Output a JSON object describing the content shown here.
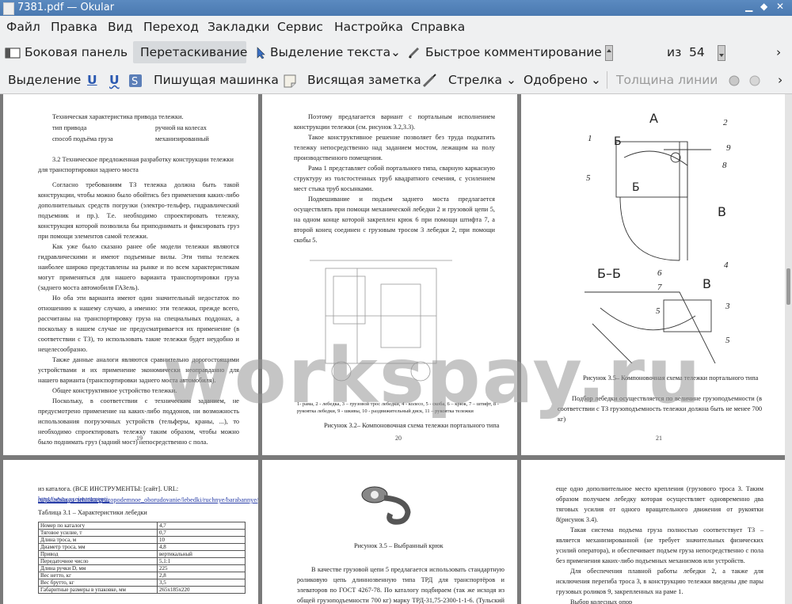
{
  "window": {
    "title": "7381.pdf — Okular"
  },
  "menu": [
    "Файл",
    "Правка",
    "Вид",
    "Переход",
    "Закладки",
    "Сервис",
    "Настройка",
    "Справка"
  ],
  "toolbar1": {
    "sidebar": "Боковая панель",
    "drag": "Перетаскивание",
    "text_select": "Выделение текста",
    "quick_comment": "Быстрое комментирование",
    "page_current": "20",
    "page_of": "из",
    "page_total": "54"
  },
  "toolbar2": {
    "selection": "Выделение",
    "typewriter": "Пишущая машинка",
    "note": "Висящая заметка",
    "arrow": "Стрелка",
    "approved": "Одобрено",
    "line_width": "Толщина линии"
  },
  "watermark": "workspay.ru",
  "page19": {
    "l1": "Техническая характеристика привода тележки.",
    "l2a": "тип привода",
    "l2b": "ручной на колесах",
    "l3a": "способ подъёма груза",
    "l3b": "механизированный",
    "h": "3.2 Техническое предложенная разработку конструкции тележки для транспортировки заднего моста",
    "p1": "Согласно требованиям ТЗ тележка должна быть такой конструкции, чтобы можно было обойтись без применения каких-либо дополнительных средств погрузки (электро-тельфер, гидравлический подъемник и пр.). Т.е. необходимо спроектировать тележку, конструкция которой позволила бы приподнимать и фиксировать груз при помощи элементов самой тележки.",
    "p2": "Как уже было сказано ранее обе модели тележки являются гидравлическими и имеют подъемные вилы. Эти типы тележек наиболее широко представлены на рынке и по всем характеристикам могут применяться для нашего варианта транспортировки груза (заднего моста автомобиля ГАЗель).",
    "p3": "Но оба эти варианта имеют один значительный недостаток по отношению к нашему случаю, а именно: эти тележки, прежде всего, рассчитаны на транспортировку груза на специальных поддонах, а поскольку в нашем случае не предусматривается их применение (в соответствии с ТЗ), то использовать такие тележки будет неудобно и нецелесообразно.",
    "p4": "Также данные аналоги являются сравнительно дорогостоящими устройствами и их применение экономически неоправданно для нашего варианта (транспортировки заднего моста автомобиля).",
    "p5": "Общее конструктивное устройство тележки.",
    "p6": "Поскольку, в соответствии с техническим заданием, не предусмотрено применение на каких-либо поддонов, ни возможность использования погрузочных устройств (тельферы, краны, ...), то необходимо спроектировать тележку таким образом, чтобы можно было поднимать груз (задний мост) непосредственно с пола.",
    "num": "19"
  },
  "page20": {
    "p1": "Поэтому предлагается вариант с портальным исполнением конструкции тележки (см. рисунок 3.2,3.3).",
    "p2": "Такое конструктивное решение позволяет без труда подкатить тележку непосредственно над заданием мостом, лежащим на полу производственного помещения.",
    "p3": "Рама 1 представляет собой портального типа, сварную каркасную структуру из толстостенных труб квадратного сечения, с усилением мест стыка труб косынками.",
    "p4": "Подвешивание и подъем заднего моста предлагается осуществлять при помощи механической лебедки 2 и грузовой цепи 5, на одном конце которой закреплен крюк 6 при помощи штифта 7, а второй конец соединен с грузовым тросом 3 лебедки 2, при помощи скобы 5.",
    "legend": "1- рама, 2 - лебедка, 3 – грузовой трос лебедки, 4 - колесо, 5 - скоба, 6 – крюк, 7 – штифт, 8 - рукоятка лебедки, 9 - шкивы, 10 - раздвижительный диск, 11 – рукоятка тележки",
    "caption": "Рисунок 3.2– Компоновочная схема тележки портального типа",
    "num": "20"
  },
  "page21": {
    "labelA": "А",
    "labelB1": "Б",
    "labelB2": "Б",
    "labelV1": "В",
    "labelBB": "Б–Б",
    "labelV2": "В",
    "n1": "1",
    "n2": "2",
    "n9": "9",
    "n8": "8",
    "n5": "5",
    "n4": "4",
    "n6": "6",
    "n7": "7",
    "n3": "3",
    "n5b": "5",
    "n5c": "5",
    "caption": "Рисунок 3.5– Компоновочная схема тележки портального типа",
    "p1": "Подбор лебедки осуществляется по величине грузоподъемности (в соответствии с ТЗ грузоподъемность тележки должна быть не менее 700 кг)",
    "num": "21"
  },
  "page22": {
    "l1": "из каталога. (ВСЕ ИНСТРУМЕНТЫ: [сайт]. URL:",
    "link1": "http://www.vseinstrumenti.",
    "link2": "ru/skladskaya_tehnika/gruzopodemnoe_oborudovanie/lebedki/ruchnye/barabannye/)",
    "table_title": "Таблица 3.1 – Характеристики лебедки",
    "rows": [
      [
        "Номер по каталогу",
        "4,7"
      ],
      [
        "Тяговое усилие, т",
        "0,7"
      ],
      [
        "Длина троса, м",
        "10"
      ],
      [
        "Диаметр троса, мм",
        "4,8"
      ],
      [
        "Привод",
        "вертикальный"
      ],
      [
        "Передаточное число",
        "5,1:1"
      ],
      [
        "Длина ручки D, мм",
        "225"
      ],
      [
        "Вес нетто, кг",
        "2,8"
      ],
      [
        "Вес брутто, кг",
        "3,5"
      ],
      [
        "Габаритные размеры в упаковке, мм",
        "265x185x220"
      ]
    ]
  },
  "page23": {
    "caption": "Рисунок 3.5 – Выбранный крюк",
    "p1": "В качестве грузовой цепи 5 предлагается использовать стандартную роликовую цепь длиннозвенную типа ТРД для транспортёров и элеваторов по ГОСТ 4267-78. По каталогу подбираем (так же исходя из общей грузоподъемности 700 кг) марку ТРД-31,75-2300-1-1-6. (Тульский завод"
  },
  "page24": {
    "p1": "еще одно дополнительное место крепления (грузового троса 3. Таким образом получаем лебедку которая осуществляет одновременно два тяговых усилия от одного вращательного движения от рукоятки 8(рисунок 3.4).",
    "p2": "Такая система подъема груза полностью соответствует ТЗ – является механизированной (не требует значительных физических усилий оператора), и обеспечивает подъем груза непосредственно с пола без применения каких-либо подъемных механизмов или устройств.",
    "p3": "Для обеспечения плавной работы лебедки 2, а также для исключения перегиба троса 3, в конструкцию тележки введены две пары грузовых роликов 9, закрепленных на раме 1.",
    "p4": "Выбор колесных опор"
  }
}
